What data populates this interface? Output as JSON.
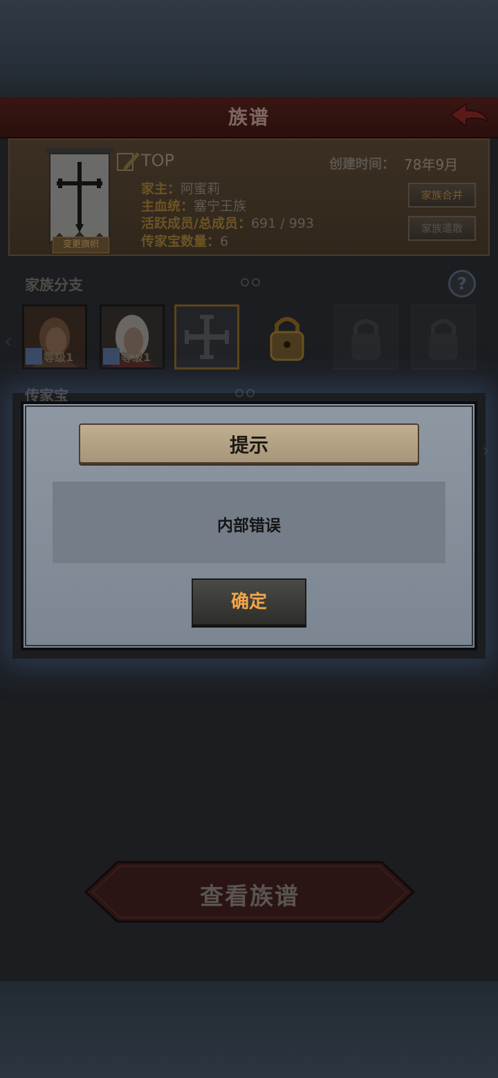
{
  "header": {
    "title": "族谱"
  },
  "family": {
    "name": "TOP",
    "created_label": "创建时间：",
    "created_value": "78年9月",
    "leader_label": "家主：",
    "leader_value": "阿蜜莉",
    "bloodline_label": "主血统：",
    "bloodline_value": "塞宁王族",
    "members_label": "活跃成员/总成员：",
    "members_value": "691 / 993",
    "heirlooms_label": "传家宝数量：",
    "heirlooms_value": "6",
    "change_banner_label": "变更旗帜",
    "merge_label": "家族合并",
    "disband_label": "家族遣散"
  },
  "branches": {
    "title": "家族分支",
    "members": [
      {
        "level_label": "等级1"
      },
      {
        "level_label": "等级1"
      }
    ]
  },
  "heirlooms": {
    "title": "传家宝"
  },
  "dialog": {
    "title": "提示",
    "message": "内部错误",
    "confirm_label": "确定"
  },
  "footer": {
    "view_tree_label": "查看族谱"
  }
}
